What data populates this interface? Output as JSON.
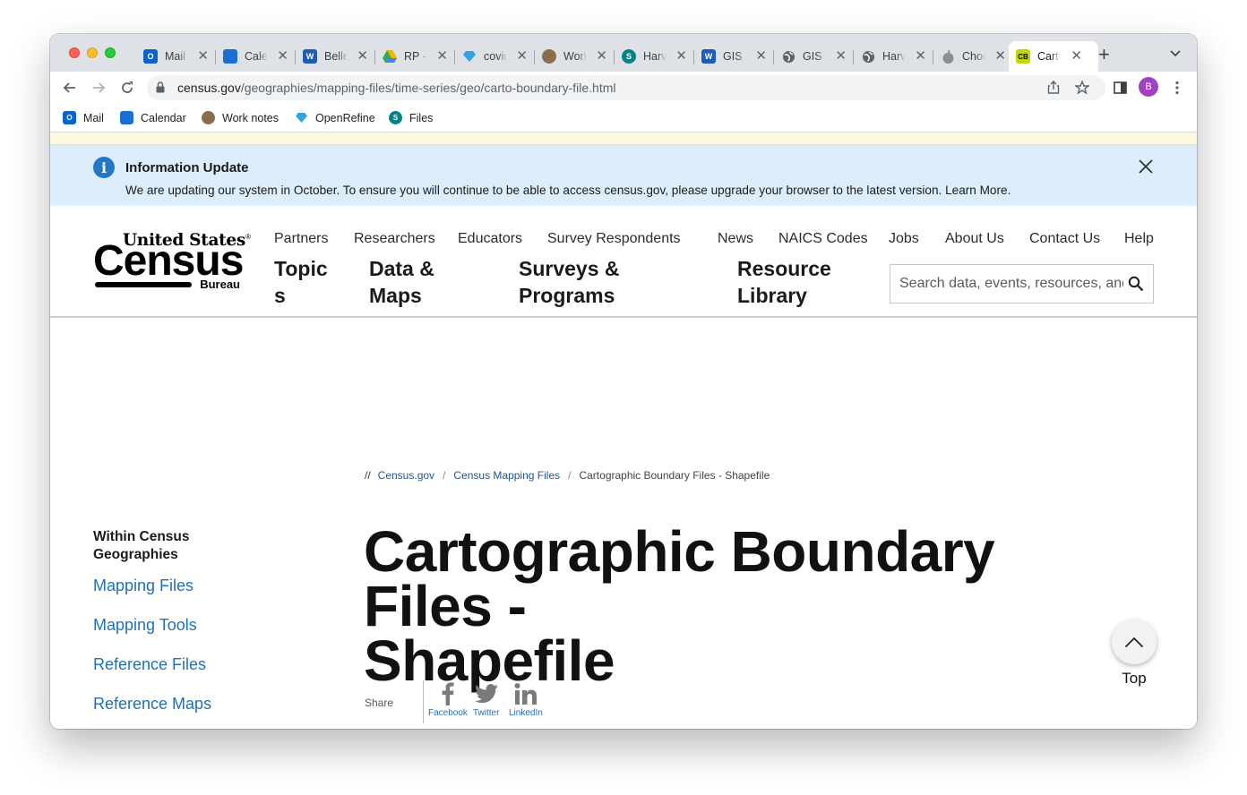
{
  "browser": {
    "tabs": [
      {
        "title": "Mail",
        "icon": "outlook-icon",
        "color": "#0a64c8",
        "glyph": "O"
      },
      {
        "title": "Calendar",
        "icon": "calendar-icon",
        "color": "#1b6fd1",
        "glyph": ""
      },
      {
        "title": "Belleville",
        "icon": "word-icon",
        "color": "#1e5bb8",
        "glyph": "W"
      },
      {
        "title": "RP - Drive",
        "icon": "drive-icon",
        "color": "#f4b400",
        "glyph": ""
      },
      {
        "title": "covid",
        "icon": "diamond-icon",
        "color": "#2fa3e6",
        "glyph": ""
      },
      {
        "title": "Work notes",
        "icon": "owl-icon",
        "color": "#8a6d4d",
        "glyph": ""
      },
      {
        "title": "Harvard",
        "icon": "sharepoint-icon",
        "color": "#038387",
        "glyph": "S"
      },
      {
        "title": "GIS Word",
        "icon": "word-icon",
        "color": "#1e5bb8",
        "glyph": "W"
      },
      {
        "title": "GIS",
        "icon": "globe-icon",
        "color": "#5f6368",
        "glyph": ""
      },
      {
        "title": "Harvard",
        "icon": "globe-icon",
        "color": "#5f6368",
        "glyph": ""
      },
      {
        "title": "Choose",
        "icon": "apple-icon",
        "color": "#8e8e8e",
        "glyph": ""
      },
      {
        "title": "Cartographic",
        "icon": "census-bureau-icon",
        "color": "#c4d600",
        "glyph": "CB"
      }
    ],
    "url_domain": "census.gov",
    "url_path": "/geographies/mapping-files/time-series/geo/carto-boundary-file.html",
    "profile_initial": "B",
    "bookmarks": [
      {
        "label": "Mail",
        "icon": "outlook-icon",
        "color": "#0a64c8",
        "glyph": "O"
      },
      {
        "label": "Calendar",
        "icon": "calendar-icon",
        "color": "#1b6fd1",
        "glyph": ""
      },
      {
        "label": "Work notes",
        "icon": "owl-icon",
        "color": "#8a6d4d",
        "glyph": ""
      },
      {
        "label": "OpenRefine",
        "icon": "diamond-icon",
        "color": "#2fa3e6",
        "glyph": ""
      },
      {
        "label": "Files",
        "icon": "sharepoint-icon",
        "color": "#038387",
        "glyph": "S"
      }
    ]
  },
  "banner": {
    "title": "Information Update",
    "text": "We are updating our system in October. To ensure you will continue to be able to access census.gov, please upgrade your browser to the latest version. Learn More."
  },
  "logo": {
    "line1": "United States",
    "reg": "®",
    "line2": "Census",
    "line3": "Bureau"
  },
  "utility_nav": [
    "Partners",
    "Researchers",
    "Educators",
    "Survey Respondents",
    "News",
    "NAICS Codes",
    "Jobs",
    "About Us",
    "Contact Us",
    "Help"
  ],
  "main_nav": [
    {
      "line1": "Topic",
      "line2": "s"
    },
    {
      "line1": "Data &",
      "line2": "Maps"
    },
    {
      "line1": "Surveys &",
      "line2": "Programs"
    },
    {
      "line1": "Resource",
      "line2": "Library"
    }
  ],
  "search": {
    "placeholder": "Search data, events, resources, and more"
  },
  "breadcrumb": {
    "start": "//",
    "items": [
      "Census.gov",
      "Census Mapping Files"
    ],
    "current": "Cartographic Boundary Files - Shapefile"
  },
  "sidebar": {
    "heading": "Within Census Geographies",
    "links": [
      "Mapping Files",
      "Mapping Tools",
      "Reference Files",
      "Reference Maps"
    ]
  },
  "page_title_line1": "Cartographic Boundary Files -",
  "page_title_line2": "Shapefile",
  "share": {
    "label": "Share",
    "items": [
      {
        "label": "Facebook",
        "icon": "facebook-icon"
      },
      {
        "label": "Twitter",
        "icon": "twitter-icon"
      },
      {
        "label": "LinkedIn",
        "icon": "linkedin-icon"
      }
    ]
  },
  "top_button": {
    "label": "Top"
  },
  "colors": {
    "link": "#2370b3",
    "banner_bg": "#dceefb",
    "info_icon": "#2377c9",
    "accent_profile": "#a142c4"
  }
}
